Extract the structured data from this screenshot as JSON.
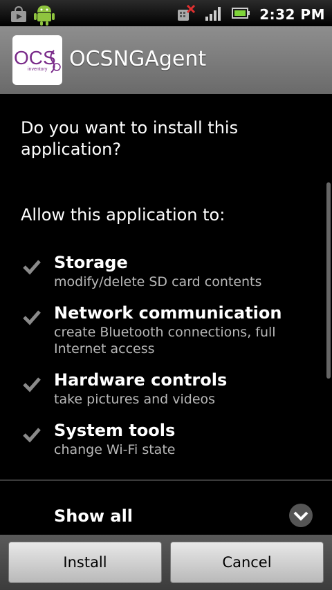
{
  "status_bar": {
    "time": "2:32 PM",
    "icons": [
      "market-download-icon",
      "android-icon",
      "sim-error-icon",
      "signal-icon",
      "battery-icon"
    ]
  },
  "app": {
    "name": "OCSNGAgent",
    "icon_text": "OCS",
    "icon_subtext": "inventory"
  },
  "dialog": {
    "question": "Do you want to install this application?",
    "allow_heading": "Allow this application to:",
    "permissions": [
      {
        "title": "Storage",
        "description": "modify/delete SD card contents"
      },
      {
        "title": "Network communication",
        "description": "create Bluetooth connections, full Internet access"
      },
      {
        "title": "Hardware controls",
        "description": "take pictures and videos"
      },
      {
        "title": "System tools",
        "description": "change Wi-Fi state"
      }
    ],
    "show_all": "Show all"
  },
  "buttons": {
    "install": "Install",
    "cancel": "Cancel"
  },
  "colors": {
    "background": "#000000",
    "header": "#7c7c7c",
    "secondary_text": "#b9b9b9",
    "error": "#e03030"
  }
}
